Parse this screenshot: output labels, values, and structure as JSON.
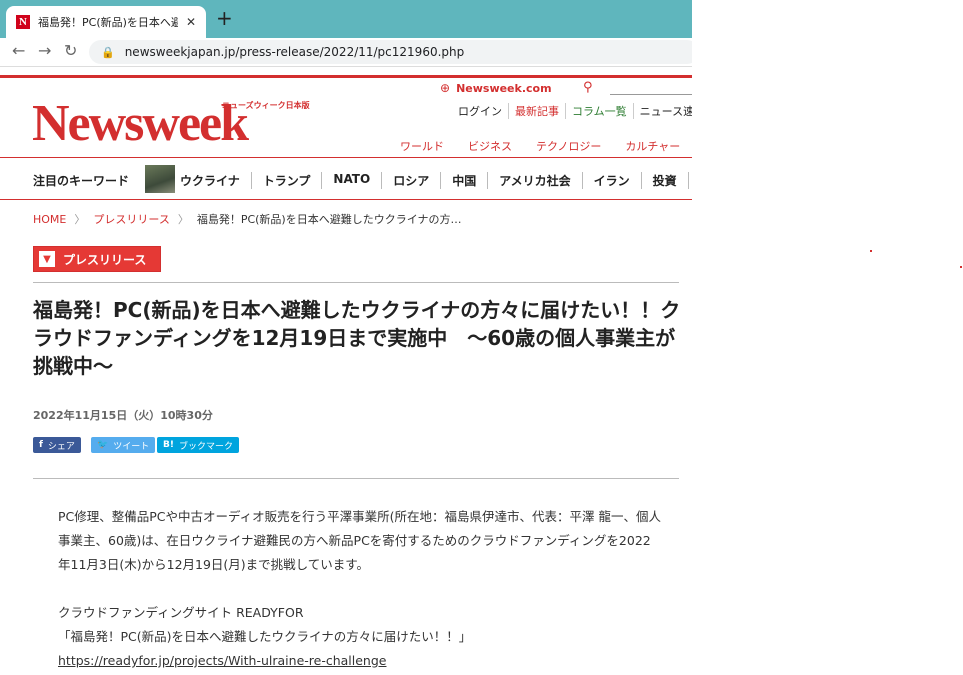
{
  "browser": {
    "tab_title": "福島発！PC(新品)を日本へ避難した",
    "tab_favicon": "N",
    "url": "newsweekjapan.jp/press-release/2022/11/pc121960.php"
  },
  "header": {
    "logo": "Newsweek",
    "logo_sub": "ニューズウィーク日本版",
    "site_link": "Newsweek.com",
    "sublinks": [
      "ログイン",
      "最新記事",
      "コラム一覧",
      "ニュース速報"
    ],
    "categories": [
      "ワールド",
      "ビジネス",
      "テクノロジー",
      "カルチャー"
    ]
  },
  "keywords": {
    "label": "注目のキーワード",
    "items": [
      "ウクライナ",
      "トランプ",
      "NATO",
      "ロシア",
      "中国",
      "アメリカ社会",
      "イラン",
      "投資"
    ]
  },
  "breadcrumb": {
    "home": "HOME",
    "section": "プレスリリース",
    "current": "福島発！PC(新品)を日本へ避難したウクライナの方…"
  },
  "badge": "プレスリリース",
  "article": {
    "title": "福島発！PC(新品)を日本へ避難したウクライナの方々に届けたい！！クラウドファンディングを12月19日まで実施中　～60歳の個人事業主が挑戦中～",
    "date": "2022年11月15日（火）10時30分",
    "share": {
      "facebook": "シェア",
      "twitter": "ツイート",
      "hatena": "ブックマーク"
    },
    "paragraph1": "PC修理、整備品PCや中古オーディオ販売を行う平澤事業所(所在地：福島県伊達市、代表：平澤 龍一、個人事業主、60歳)は、在日ウクライナ避難民の方へ新品PCを寄付するためのクラウドファンディングを2022年11月3日(木)から12月19日(月)まで挑戦しています。",
    "line_site": "クラウドファンディングサイト READYFOR",
    "line_project": "「福島発！PC(新品)を日本へ避難したウクライナの方々に届けたい！！」",
    "line_url": "https://readyfor.jp/projects/With-ulraine-re-challenge"
  },
  "colors": {
    "accent": "#d32f2f",
    "facebook": "#3b5998",
    "twitter": "#55acee",
    "hatena": "#00a4de",
    "tabstrip": "#5fb6bd"
  }
}
